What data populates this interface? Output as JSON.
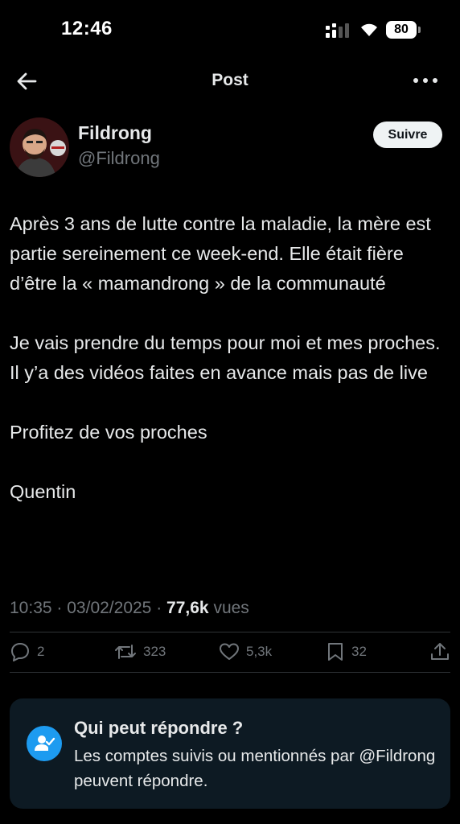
{
  "status_bar": {
    "time": "12:46",
    "battery": "80"
  },
  "nav": {
    "title": "Post"
  },
  "author": {
    "name": "Fildrong",
    "handle": "@Fildrong",
    "follow_label": "Suivre"
  },
  "post": {
    "paragraphs": [
      "Après 3 ans de lutte contre la maladie, la mère est partie sereinement ce week-end. Elle était fière d’être la « mamandrong » de la communauté",
      "Je vais prendre du temps pour moi et mes proches. Il y’a des vidéos faites en avance mais pas de live",
      "Profitez de vos proches",
      "Quentin"
    ],
    "time": "10:35",
    "date": "03/02/2025",
    "views_count": "77,6k",
    "views_label": "vues",
    "separator": "·"
  },
  "actions": {
    "replies": "2",
    "reposts": "323",
    "likes": "5,3k",
    "bookmarks": "32"
  },
  "reply_restriction": {
    "title": "Qui peut répondre ?",
    "description": "Les comptes suivis ou mentionnés par @Fildrong peuvent répondre."
  },
  "colors": {
    "accent": "#1d9bf0",
    "muted": "#71767b",
    "text": "#e7e9ea",
    "card": "#0d1a23"
  }
}
